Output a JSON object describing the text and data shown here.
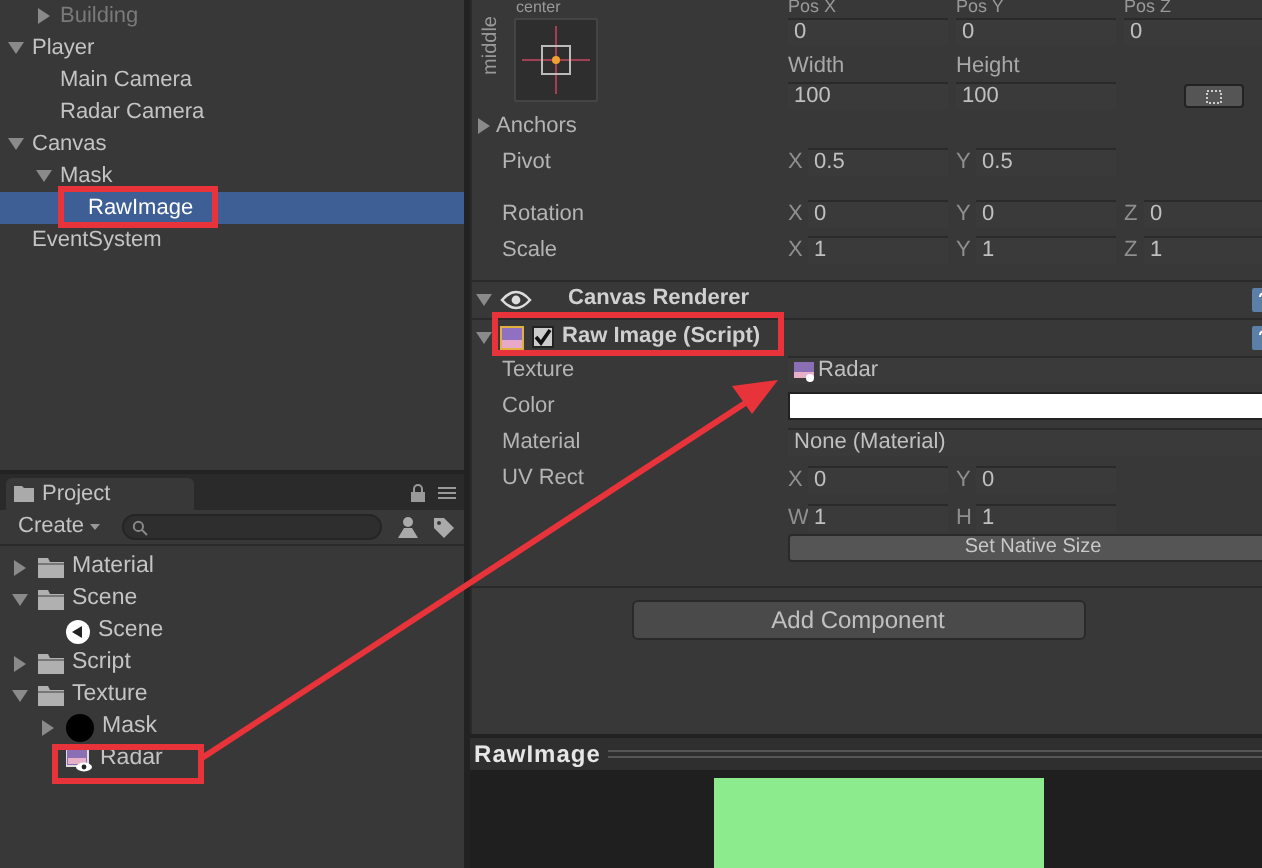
{
  "hierarchy": {
    "items": [
      {
        "label": "Building",
        "kind": "continued",
        "active": false,
        "expanded": false,
        "selected": false
      },
      {
        "label": "Player",
        "kind": "node",
        "active": true,
        "expanded": true,
        "selected": false,
        "children": [
          {
            "label": "Main Camera",
            "kind": "node",
            "active": true,
            "selected": false
          },
          {
            "label": "Radar Camera",
            "kind": "node",
            "active": true,
            "selected": false
          }
        ]
      },
      {
        "label": "Canvas",
        "kind": "node",
        "active": true,
        "expanded": true,
        "selected": false,
        "children": [
          {
            "label": "Mask",
            "kind": "node",
            "active": true,
            "expanded": true,
            "selected": false,
            "children": [
              {
                "label": "RawImage",
                "kind": "node",
                "active": true,
                "selected": true
              }
            ]
          }
        ]
      },
      {
        "label": "EventSystem",
        "kind": "node",
        "active": true,
        "selected": false
      }
    ]
  },
  "project": {
    "tab": "Project",
    "create_button": "Create",
    "items": [
      {
        "label": "Material",
        "kind": "folder",
        "expanded": false
      },
      {
        "label": "Scene",
        "kind": "folder",
        "expanded": true,
        "children": [
          {
            "label": "Scene",
            "kind": "scene"
          }
        ]
      },
      {
        "label": "Script",
        "kind": "folder",
        "expanded": false
      },
      {
        "label": "Texture",
        "kind": "folder",
        "expanded": true,
        "children": [
          {
            "label": "Mask",
            "kind": "sprite",
            "expanded": false
          },
          {
            "label": "Radar",
            "kind": "texture"
          }
        ]
      }
    ]
  },
  "inspector": {
    "rect": {
      "anchor_horizontal": "center",
      "anchor_vertical": "middle",
      "position": [
        {
          "label": "Pos X",
          "value": "0"
        },
        {
          "label": "Pos Y",
          "value": "0"
        },
        {
          "label": "Pos Z",
          "value": "0"
        }
      ],
      "size": [
        {
          "label": "Width",
          "value": "100"
        },
        {
          "label": "Height",
          "value": "100"
        }
      ]
    },
    "properties": [
      {
        "label": "Anchors",
        "kind": "foldout",
        "expanded": false
      },
      {
        "label": "Pivot",
        "kind": "vector",
        "fields": [
          {
            "axis": "X",
            "value": "0.5"
          },
          {
            "axis": "Y",
            "value": "0.5"
          }
        ]
      },
      {
        "label": "Rotation",
        "kind": "vector",
        "fields": [
          {
            "axis": "X",
            "value": "0"
          },
          {
            "axis": "Y",
            "value": "0"
          },
          {
            "axis": "Z",
            "value": "0"
          }
        ]
      },
      {
        "label": "Scale",
        "kind": "vector",
        "fields": [
          {
            "axis": "X",
            "value": "1"
          },
          {
            "axis": "Y",
            "value": "1"
          },
          {
            "axis": "Z",
            "value": "1"
          }
        ]
      }
    ],
    "components": [
      {
        "title": "Canvas Renderer",
        "kind": "renderer",
        "expanded": true
      },
      {
        "title": "Raw Image (Script)",
        "kind": "script",
        "expanded": true,
        "enabled": true
      }
    ],
    "raw_image_fields": [
      {
        "label": "Texture",
        "kind": "object",
        "value": "Radar"
      },
      {
        "label": "Color",
        "kind": "color",
        "color": "#ffffff"
      },
      {
        "label": "Material",
        "kind": "object",
        "value": "None (Material)"
      },
      {
        "label": "UV Rect",
        "kind": "rect",
        "fields": [
          {
            "axis": "X",
            "value": "0"
          },
          {
            "axis": "Y",
            "value": "0"
          },
          {
            "axis": "W",
            "value": "1"
          },
          {
            "axis": "H",
            "value": "1"
          }
        ]
      }
    ],
    "native_size_button": "Set Native Size",
    "add_component_button": "Add Component"
  },
  "preview": {
    "title": "RawImage"
  }
}
